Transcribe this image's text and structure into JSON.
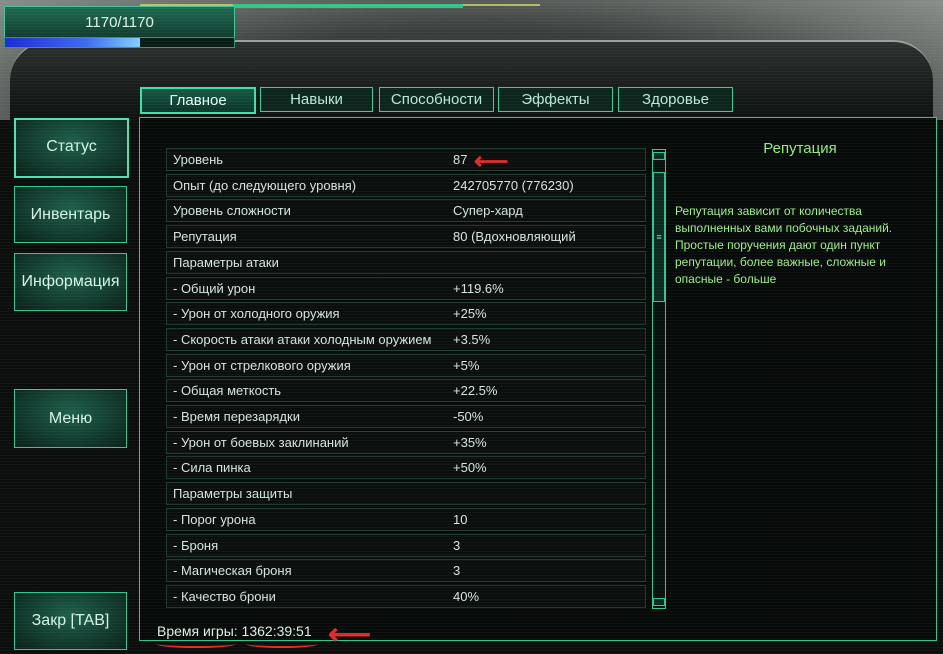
{
  "hp": {
    "text": "1170/1170",
    "bar_fraction": 0.59
  },
  "tabs": [
    {
      "label": "Главное",
      "active": true
    },
    {
      "label": "Навыки",
      "active": false
    },
    {
      "label": "Способности",
      "active": false
    },
    {
      "label": "Эффекты",
      "active": false
    },
    {
      "label": "Здоровье",
      "active": false
    }
  ],
  "sidebar": {
    "status": "Статус",
    "inventory": "Инвентарь",
    "info": "Информация",
    "menu": "Меню",
    "close": "Закр [TAB]"
  },
  "rows": [
    {
      "label": "Уровень",
      "value": "87"
    },
    {
      "label": "Опыт (до следующего уровня)",
      "value": "242705770 (776230)"
    },
    {
      "label": "Уровень сложности",
      "value": "Супер-хард"
    },
    {
      "label": "Репутация",
      "value": "80 (Вдохновляющий"
    },
    {
      "label": "Параметры атаки",
      "value": ""
    },
    {
      "label": "-  Общий урон",
      "value": "+119.6%"
    },
    {
      "label": "-  Урон от холодного оружия",
      "value": "+25%"
    },
    {
      "label": "-  Скорость атаки атаки холодным оружием",
      "value": "+3.5%"
    },
    {
      "label": "-  Урон от стрелкового оружия",
      "value": "+5%"
    },
    {
      "label": "-  Общая меткость",
      "value": "+22.5%"
    },
    {
      "label": "-  Время перезарядки",
      "value": "-50%"
    },
    {
      "label": "-  Урон от боевых заклинаний",
      "value": "+35%"
    },
    {
      "label": "-  Сила пинка",
      "value": "+50%"
    },
    {
      "label": "Параметры защиты",
      "value": ""
    },
    {
      "label": "-  Порог урона",
      "value": "10"
    },
    {
      "label": "-  Броня",
      "value": "3"
    },
    {
      "label": "-  Магическая броня",
      "value": "3"
    },
    {
      "label": "-  Качество брони",
      "value": "40%"
    }
  ],
  "scrollbar": {
    "thumb_glyph": "≡"
  },
  "reputation": {
    "title": "Репутация",
    "description": "Репутация зависит от количества выполненных вами побочных заданий. Простые поручения дают один пункт репутации, более важные, сложные и опасные - больше"
  },
  "game_time": "Время игры: 1362:39:51",
  "annotations": {
    "arrow_glyph": "⟵",
    "color": "#e12a2a"
  },
  "colors": {
    "accent": "#2fc691",
    "panel_bg": "#060a08",
    "rep_text": "#9ef085"
  }
}
